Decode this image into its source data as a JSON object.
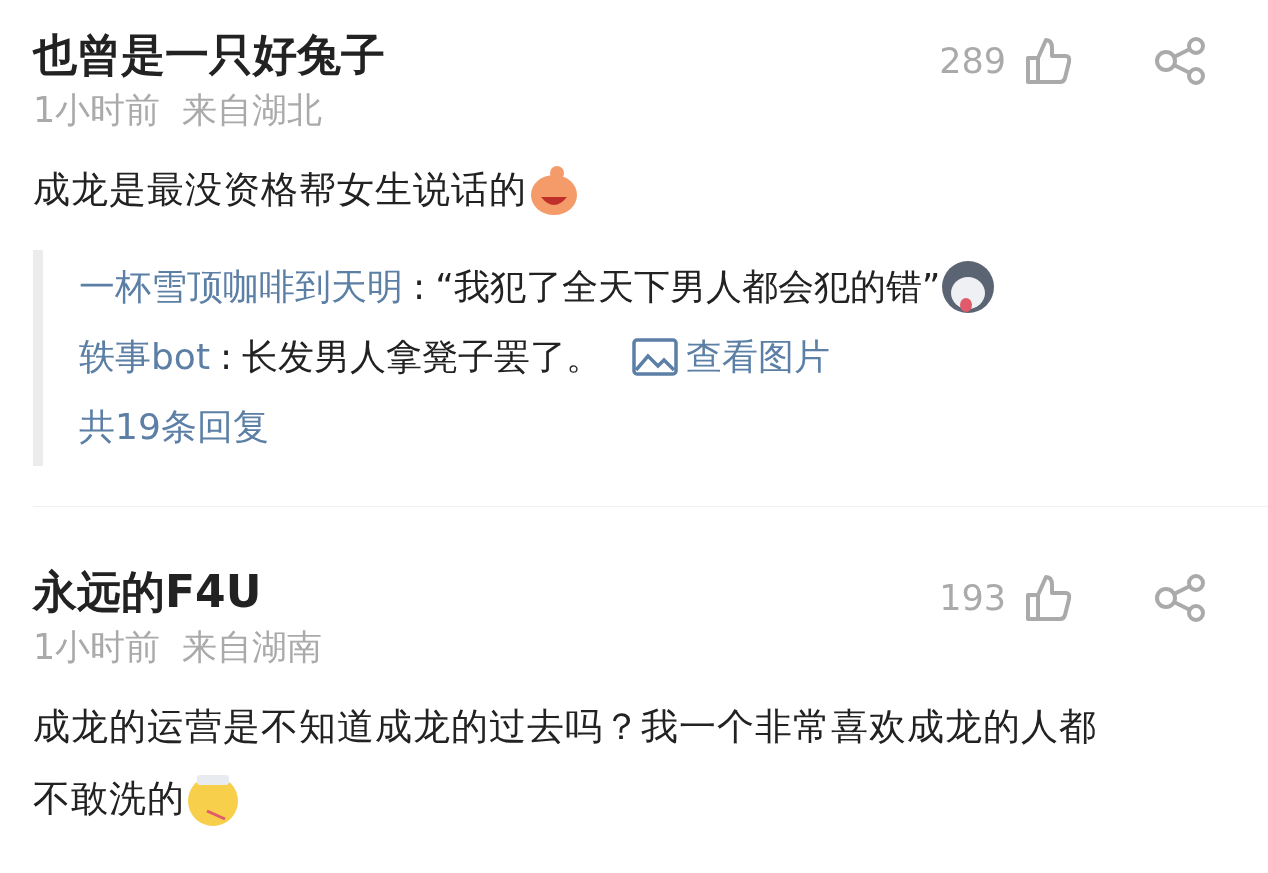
{
  "comments": [
    {
      "author": "也曾是一只好兔子",
      "time": "1小时前",
      "location": "来自湖北",
      "likes": "289",
      "lines": [
        "成龙是最没资格帮女生说话的"
      ],
      "sticker": {
        "kind": "grin"
      },
      "replies": [
        {
          "author": "一杯雪顶咖啡到天明",
          "separator": ":",
          "text": "“我犯了全天下男人都会犯的错”",
          "sticker": {
            "kind": "dog"
          }
        },
        {
          "author": "轶事bot",
          "separator": ":",
          "text": "长发男人拿凳子罢了。",
          "link": "查看图片"
        }
      ],
      "reply_count": "共19条回复"
    },
    {
      "author": "永远的F4U",
      "time": "1小时前",
      "location": "来自湖南",
      "likes": "193",
      "lines": [
        "成龙的运营是不知道成龙的过去吗？我一个非常喜欢成龙的人都",
        "不敢洗的"
      ],
      "sticker": {
        "kind": "sick"
      }
    }
  ]
}
